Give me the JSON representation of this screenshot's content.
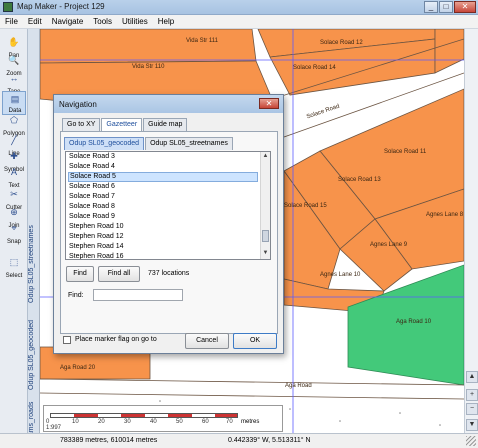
{
  "window": {
    "title": "Map Maker - Project 129",
    "minimize": "_",
    "maximize": "□",
    "close": "✕"
  },
  "menubar": [
    "File",
    "Edit",
    "Navigate",
    "Tools",
    "Utilities",
    "Help"
  ],
  "toolbox": [
    {
      "label": "Pan",
      "icon": "pan-icon",
      "glyph": "✋"
    },
    {
      "label": "Zoom",
      "icon": "zoom-icon",
      "glyph": "🔍"
    },
    {
      "label": "Tape",
      "icon": "tape-icon",
      "glyph": "↔"
    },
    {
      "label": "Data",
      "icon": "data-icon",
      "glyph": "▤"
    },
    {
      "label": "Polygon",
      "icon": "polygon-icon",
      "glyph": "⬠"
    },
    {
      "label": "Line",
      "icon": "line-icon",
      "glyph": "╱"
    },
    {
      "label": "Symbol",
      "icon": "symbol-icon",
      "glyph": "✚"
    },
    {
      "label": "Text",
      "icon": "text-icon",
      "glyph": "A"
    },
    {
      "label": "Cutter",
      "icon": "cutter-icon",
      "glyph": "✂"
    },
    {
      "label": "Join",
      "icon": "join-icon",
      "glyph": "⊕"
    },
    {
      "label": "Snap",
      "icon": "snap-icon",
      "glyph": "⌖"
    },
    {
      "label": "Select",
      "icon": "select-icon",
      "glyph": "⬚"
    }
  ],
  "layers": [
    "Odup SL05_streetnames",
    "Odup SL05_geocoded",
    "Ortams_roads"
  ],
  "map_labels": {
    "vida111": "Vida Str 111",
    "vida110": "Vida Str 110",
    "solace12": "Solace Road 12",
    "solace14": "Solace Road 14",
    "solaceRoad": "Solace Road",
    "solace11": "Solace Road 11",
    "solace13": "Solace Road 13",
    "solace15": "Solace Road 15",
    "agnes8": "Agnes Lane 8",
    "agnes9": "Agnes Lane 9",
    "agnes10": "Agnes Lane 10",
    "aga10": "Aga Road 10",
    "aga20": "Aga Road 20",
    "agaRoad": "Aga Road"
  },
  "dialog": {
    "title": "Navigation",
    "close": "✕",
    "tabs": [
      "Go to XY",
      "Gazetteer",
      "Guide map"
    ],
    "selected_tab": "Gazetteer",
    "subtabs": [
      "Odup SL05_geocoded",
      "Odup SL05_streetnames"
    ],
    "selected_subtab": "Odup SL05_geocoded",
    "list_items": [
      "Solace Road 3",
      "Solace Road 4",
      "Solace Road 5",
      "Solace Road 6",
      "Solace Road 7",
      "Solace Road 8",
      "Solace Road 9",
      "Stephen Road 10",
      "Stephen Road 12",
      "Stephen Road 14",
      "Stephen Road 16"
    ],
    "selected_item": "Solace Road 5",
    "find_button": "Find",
    "find_all_button": "Find all",
    "location_count": "737 locations",
    "find_label": "Find:",
    "find_value": "",
    "marker_flag_label": "Place marker flag on go to",
    "marker_flag_checked": false,
    "cancel_button": "Cancel",
    "ok_button": "OK"
  },
  "scalebar": {
    "ticks": [
      "0",
      "10",
      "20",
      "30",
      "40",
      "50",
      "60",
      "70"
    ],
    "left_label": "1:997",
    "unit": "metres"
  },
  "status": {
    "coords": "783389 metres, 610014 metres",
    "latlon": "0.442339° W,  5.513311° N"
  },
  "colors": {
    "parcel": "#f7934b",
    "park": "#43c97a",
    "road": "#ffffff",
    "parcel_line": "#6b5442",
    "grid": "#5c5cff",
    "selection": "#cde4ff"
  }
}
